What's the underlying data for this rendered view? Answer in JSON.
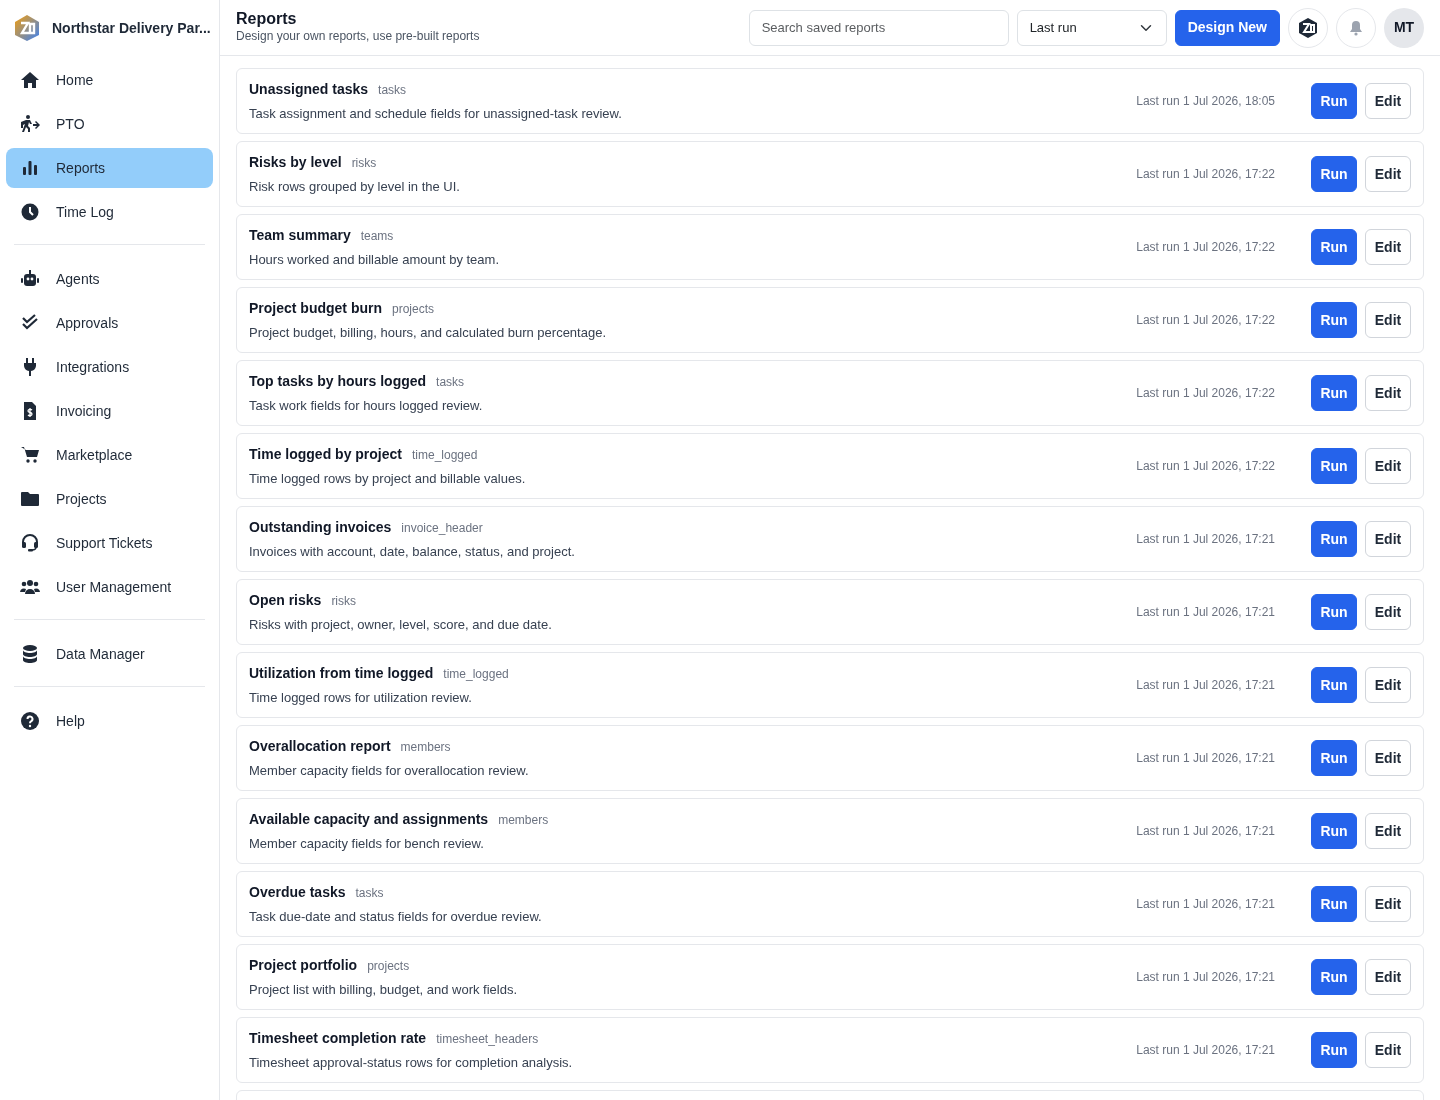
{
  "brand": {
    "name": "Northstar Delivery Par..."
  },
  "sidebar": {
    "groups": [
      [
        {
          "label": "Home",
          "selected": false
        },
        {
          "label": "PTO",
          "selected": false
        },
        {
          "label": "Reports",
          "selected": true
        },
        {
          "label": "Time Log",
          "selected": false
        }
      ],
      [
        {
          "label": "Agents",
          "selected": false
        },
        {
          "label": "Approvals",
          "selected": false
        },
        {
          "label": "Integrations",
          "selected": false
        },
        {
          "label": "Invoicing",
          "selected": false
        },
        {
          "label": "Marketplace",
          "selected": false
        },
        {
          "label": "Projects",
          "selected": false
        },
        {
          "label": "Support Tickets",
          "selected": false
        },
        {
          "label": "User Management",
          "selected": false
        }
      ],
      [
        {
          "label": "Data Manager",
          "selected": false
        }
      ],
      [
        {
          "label": "Help",
          "selected": false
        }
      ]
    ]
  },
  "header": {
    "title": "Reports",
    "subtitle": "Design your own reports, use pre-built reports",
    "search": {
      "placeholder": "Search saved reports"
    },
    "sort": {
      "value": "Last run"
    },
    "design_button": "Design New",
    "avatar": "MT"
  },
  "reports": [
    {
      "title": "Unassigned tasks",
      "source": "tasks",
      "description": "Task assignment and schedule fields for unassigned-task review.",
      "last_run": "Last run 1 Jul 2026, 18:05",
      "run": "Run",
      "edit": "Edit"
    },
    {
      "title": "Risks by level",
      "source": "risks",
      "description": "Risk rows grouped by level in the UI.",
      "last_run": "Last run 1 Jul 2026, 17:22",
      "run": "Run",
      "edit": "Edit"
    },
    {
      "title": "Team summary",
      "source": "teams",
      "description": "Hours worked and billable amount by team.",
      "last_run": "Last run 1 Jul 2026, 17:22",
      "run": "Run",
      "edit": "Edit"
    },
    {
      "title": "Project budget burn",
      "source": "projects",
      "description": "Project budget, billing, hours, and calculated burn percentage.",
      "last_run": "Last run 1 Jul 2026, 17:22",
      "run": "Run",
      "edit": "Edit"
    },
    {
      "title": "Top tasks by hours logged",
      "source": "tasks",
      "description": "Task work fields for hours logged review.",
      "last_run": "Last run 1 Jul 2026, 17:22",
      "run": "Run",
      "edit": "Edit"
    },
    {
      "title": "Time logged by project",
      "source": "time_logged",
      "description": "Time logged rows by project and billable values.",
      "last_run": "Last run 1 Jul 2026, 17:22",
      "run": "Run",
      "edit": "Edit"
    },
    {
      "title": "Outstanding invoices",
      "source": "invoice_header",
      "description": "Invoices with account, date, balance, status, and project.",
      "last_run": "Last run 1 Jul 2026, 17:21",
      "run": "Run",
      "edit": "Edit"
    },
    {
      "title": "Open risks",
      "source": "risks",
      "description": "Risks with project, owner, level, score, and due date.",
      "last_run": "Last run 1 Jul 2026, 17:21",
      "run": "Run",
      "edit": "Edit"
    },
    {
      "title": "Utilization from time logged",
      "source": "time_logged",
      "description": "Time logged rows for utilization review.",
      "last_run": "Last run 1 Jul 2026, 17:21",
      "run": "Run",
      "edit": "Edit"
    },
    {
      "title": "Overallocation report",
      "source": "members",
      "description": "Member capacity fields for overallocation review.",
      "last_run": "Last run 1 Jul 2026, 17:21",
      "run": "Run",
      "edit": "Edit"
    },
    {
      "title": "Available capacity and assignments",
      "source": "members",
      "description": "Member capacity fields for bench review.",
      "last_run": "Last run 1 Jul 2026, 17:21",
      "run": "Run",
      "edit": "Edit"
    },
    {
      "title": "Overdue tasks",
      "source": "tasks",
      "description": "Task due-date and status fields for overdue review.",
      "last_run": "Last run 1 Jul 2026, 17:21",
      "run": "Run",
      "edit": "Edit"
    },
    {
      "title": "Project portfolio",
      "source": "projects",
      "description": "Project list with billing, budget, and work fields.",
      "last_run": "Last run 1 Jul 2026, 17:21",
      "run": "Run",
      "edit": "Edit"
    },
    {
      "title": "Timesheet completion rate",
      "source": "timesheet_headers",
      "description": "Timesheet approval-status rows for completion analysis.",
      "last_run": "Last run 1 Jul 2026, 17:21",
      "run": "Run",
      "edit": "Edit"
    }
  ]
}
